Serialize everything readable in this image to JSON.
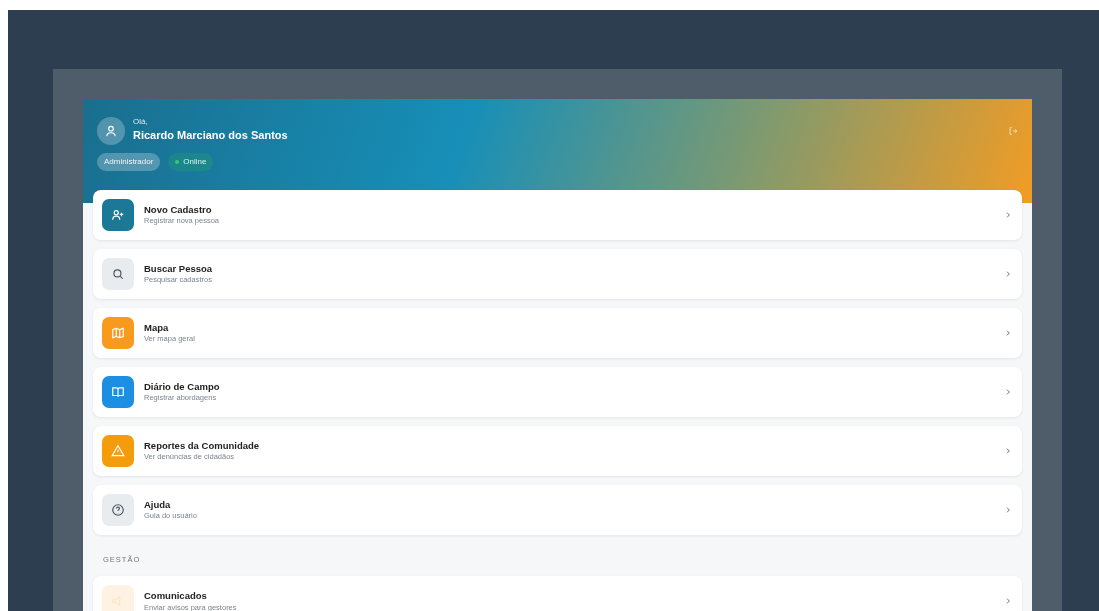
{
  "header": {
    "greeting": "Olá,",
    "user_name": "Ricardo Marciano dos Santos",
    "role_badge": "Administrador",
    "status": {
      "label": "Online",
      "online": true
    }
  },
  "menu": [
    {
      "title": "Novo Cadastro",
      "subtitle": "Registrar nova pessoa",
      "color": "#1b7896"
    },
    {
      "title": "Buscar Pessoa",
      "subtitle": "Pesquisar cadastros",
      "color": "#e9ecef"
    },
    {
      "title": "Mapa",
      "subtitle": "Ver mapa geral",
      "color": "#f79a1e"
    },
    {
      "title": "Diário de Campo",
      "subtitle": "Registrar abordagens",
      "color": "#1c8fe3"
    },
    {
      "title": "Reportes da Comunidade",
      "subtitle": "Ver denúncias de cidadãos",
      "color": "#f59c0c"
    },
    {
      "title": "Ajuda",
      "subtitle": "Guia do usuário",
      "color": "#e9ecef"
    }
  ],
  "section_label": "GESTÃO",
  "management": [
    {
      "title": "Comunicados",
      "subtitle": "Enviar avisos para gestores",
      "color": "#fef3e2"
    }
  ]
}
